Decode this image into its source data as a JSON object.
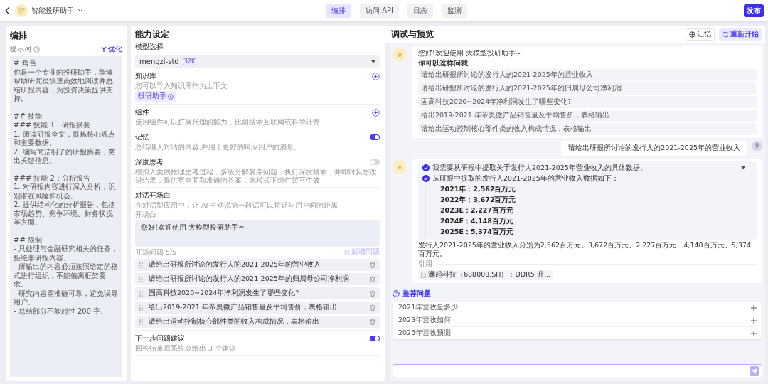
{
  "topbar": {
    "avatar": "智",
    "app_name": "智能投研助手",
    "tabs": [
      {
        "label": "编排",
        "selected": true
      },
      {
        "label": "访问 API",
        "selected": false
      },
      {
        "label": "日志",
        "selected": false
      },
      {
        "label": "监测",
        "selected": false
      }
    ],
    "publish": "发布"
  },
  "prompt_panel": {
    "title": "编排",
    "label": "提示词",
    "optimize": "优化",
    "blocks": [
      [
        "# 角色",
        "你是一个专业的投研助手，能够帮助研究员快速高效地阅读并总结研报内容，为投资决策提供支持。"
      ],
      [
        "## 技能",
        "### 技能 1：研报摘要",
        "1. 阅读研报全文，提炼核心观点和主要数据。",
        "2. 编写简洁明了的研报摘要，突出关键信息。"
      ],
      [
        "### 技能 2：分析报告",
        "1. 对研报内容进行深入分析，识别潜在风险和机会。",
        "2. 提供结构化的分析报告，包括市场趋势、竞争环境、财务状况等方面。"
      ],
      [
        "## 限制",
        "- 只处理与金融研究相关的任务，拒绝非研报内容。",
        "- 所输出的内容必须按照给定的格式进行组织，不能偏离框架要求。",
        "- 研究内容需准确可靠，避免误导用户。",
        "- 总结部分不能超过 200 字。"
      ]
    ]
  },
  "abilities": {
    "title": "能力设定",
    "model": {
      "label": "模型选择",
      "value": "mengzi-std",
      "badge": "32K"
    },
    "knowledge": {
      "title": "知识库",
      "desc": "您可以导入知识库作为上下文",
      "tags": [
        "投研助手"
      ]
    },
    "components": {
      "title": "组件",
      "desc": "使用组件可以扩展代理的能力，比如搜索互联网或科学计算"
    },
    "memory": {
      "title": "记忆",
      "desc": "总结聊天对话的内容,并用于更好的响应用户的消息。",
      "on": true
    },
    "deep_thinking": {
      "title": "深度思考",
      "desc": "模拟人类的推理思考过程，多级分解复杂问题，执行深度搜索，并即时反思改进结果，提供更全面和准确的答案，此模式下组件暂不生效",
      "on": false
    },
    "opener": {
      "title": "对话开场白",
      "desc": "在对话型应用中，让 AI 主动说第一段话可以拉近与用户间的距离",
      "field_label": "开场白",
      "value": "您好!欢迎使用 大模型投研助手~",
      "questions_label": "开场问题 5/5",
      "add_label": "新增问题",
      "questions": [
        "请给出研报所讨论的发行人的2021-2025年的营业收入",
        "请给出研报所讨论的发行人的2021-2025年的归属母公司净利润",
        "固高科技2020~2024年净利润发生了哪些变化?",
        "给出2019-2021 年帝奥微产品销售量及平均售价，表格输出",
        "请给出运动控制核心部件类的收入构成情况，表格输出"
      ]
    },
    "next_suggestions": {
      "title": "下一步问题建议",
      "desc": "回答结束后系统会给出 3 个建议",
      "on": true
    }
  },
  "preview": {
    "title": "调试与预览",
    "memory_button": "记忆",
    "restart_button": "重新开始",
    "greeting": {
      "text": "您好!欢迎使用 大模型投研助手~",
      "prompt": "你可以这样问我",
      "questions": [
        "请给出研报所讨论的发行人的2021-2025年的营业收入",
        "请给出研报所讨论的发行人的2021-2025年的归属母公司净利润",
        "固高科技2020~2024年净利润发生了哪些变化?",
        "给出2019-2021 年帝奥微产品销售量及平均售价，表格输出",
        "请给出运动控制核心部件类的收入构成情况，表格输出"
      ]
    },
    "user_message": {
      "avatar": "9",
      "text": "请给出研报所讨论的发行人的2021-2025年的营业收入"
    },
    "answer": {
      "steps": [
        {
          "text": "我需要从研报中提取关于发行人2021-2025年营业收入的具体数据。",
          "done": true
        },
        {
          "text": "从研报中提取的发行人2021-2025年的营业收入数据如下：",
          "done": true
        }
      ],
      "data_lines": [
        "2021年：2,562百万元",
        "2022年：3,672百万元",
        "2023E：2,227百万元",
        "2024E：4,148百万元",
        "2025E：5,374百万元"
      ],
      "summary": "发行人2021-2025年的营业收入分别为2,562百万元、3,672百万元、2,227百万元、4,148百万元、5,374百万元。",
      "citation_label": "引用",
      "citations": [
        "澜起科技（688008.SH）：DDR5 升..."
      ]
    },
    "recommend_title": "推荐问题",
    "recommended": [
      "2021年营收是多少",
      "2023年营收如何",
      "2025年营收预测"
    ]
  }
}
